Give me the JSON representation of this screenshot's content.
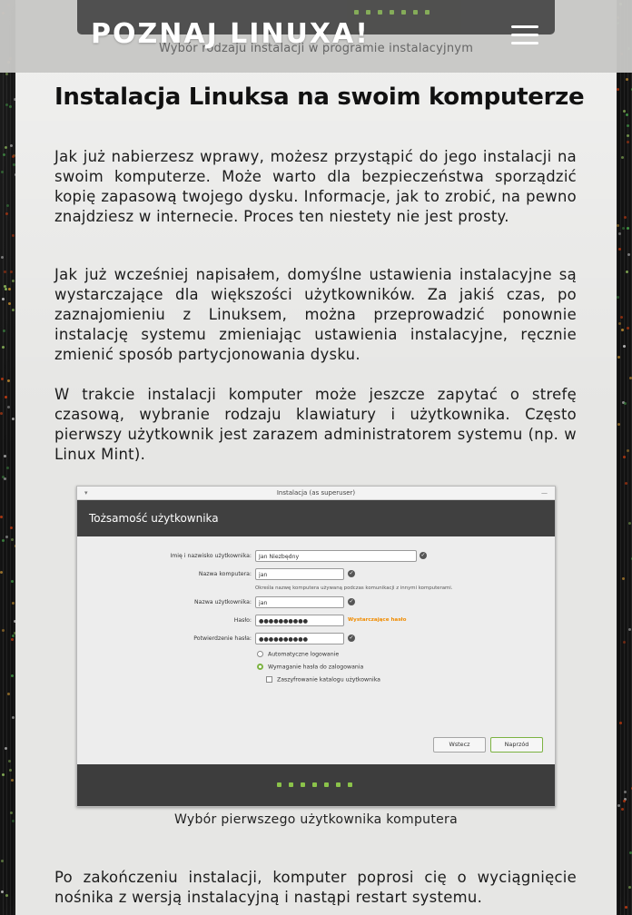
{
  "header": {
    "site_title": "POZNAJ LINUXA!",
    "prev_caption": "Wybór rodzaju instalacji w programie instalacyjnym",
    "menu_icon": "hamburger-menu-icon"
  },
  "article": {
    "heading": "Instalacja Linuksa na swoim komputerze",
    "paragraphs": [
      "Jak już nabierzesz wprawy, możesz przystąpić do jego instalacji na swoim komputerze. Może warto dla bezpieczeństwa sporządzić kopię zapasową twojego dysku. Informacje, jak to zrobić, na pewno znajdziesz w internecie. Proces ten niestety nie jest prosty.",
      "Jak już wcześniej napisałem, domyślne ustawienia instalacyjne są wystarczające dla większości użytkowników. Za jakiś czas, po zaznajomieniu z Linuksem, można przeprowadzić ponownie instalację systemu zmieniając ustawienia instalacyjne, ręcznie zmienić sposób partycjonowania dysku.",
      "W trakcie instalacji komputer może jeszcze zapytać o strefę czasową, wybranie rodzaju klawiatury i użytkownika. Często pierwszy użytkownik jest zarazem administratorem systemu (np. w Linux Mint).",
      "Po zakończeniu instalacji, komputer poprosi cię o wyciągnięcie nośnika z wersją instalacyjną i nastąpi restart systemu."
    ],
    "figure_caption": "Wybór pierwszego użytkownika komputera"
  },
  "installer": {
    "window_title": "Instalacja (as superuser)",
    "section_title": "Tożsamość użytkownika",
    "fields": [
      {
        "label": "Imię i nazwisko użytkownika:",
        "value": "Jan Niezbędny"
      },
      {
        "label": "Nazwa komputera:",
        "value": "jan"
      },
      {
        "label": "Nazwa użytkownika:",
        "value": "jan"
      },
      {
        "label": "Hasło:",
        "value": "●●●●●●●●●●",
        "hint": "Wystarczające hasło"
      },
      {
        "label": "Potwierdzenie hasła:",
        "value": "●●●●●●●●●●"
      }
    ],
    "computer_name_note": "Określa nazwę komputera używaną podczas komunikacji z innymi komputerami.",
    "options": {
      "auto_login": "Automatyczne logowanie",
      "require_password": "Wymaganie hasła do zalogowania",
      "encrypt_home": "Zaszyfrowanie katalogu użytkownika"
    },
    "buttons": {
      "back": "Wstecz",
      "next": "Naprzód"
    },
    "accent_color": "#7cb342",
    "hint_color": "#f08c00"
  }
}
